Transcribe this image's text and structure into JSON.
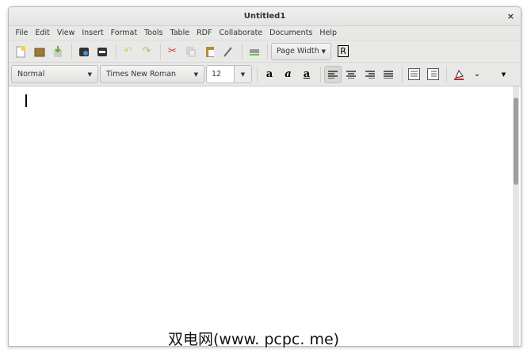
{
  "window": {
    "title": "Untitled1",
    "close": "×"
  },
  "menu": [
    "File",
    "Edit",
    "View",
    "Insert",
    "Format",
    "Tools",
    "Table",
    "RDF",
    "Collaborate",
    "Documents",
    "Help"
  ],
  "toolbar": {
    "zoom": "Page Width",
    "rdf_label": "R"
  },
  "format": {
    "style": "Normal",
    "font": "Times New Roman",
    "size": "12"
  },
  "watermark": "双电网(www. pcpc. me)"
}
